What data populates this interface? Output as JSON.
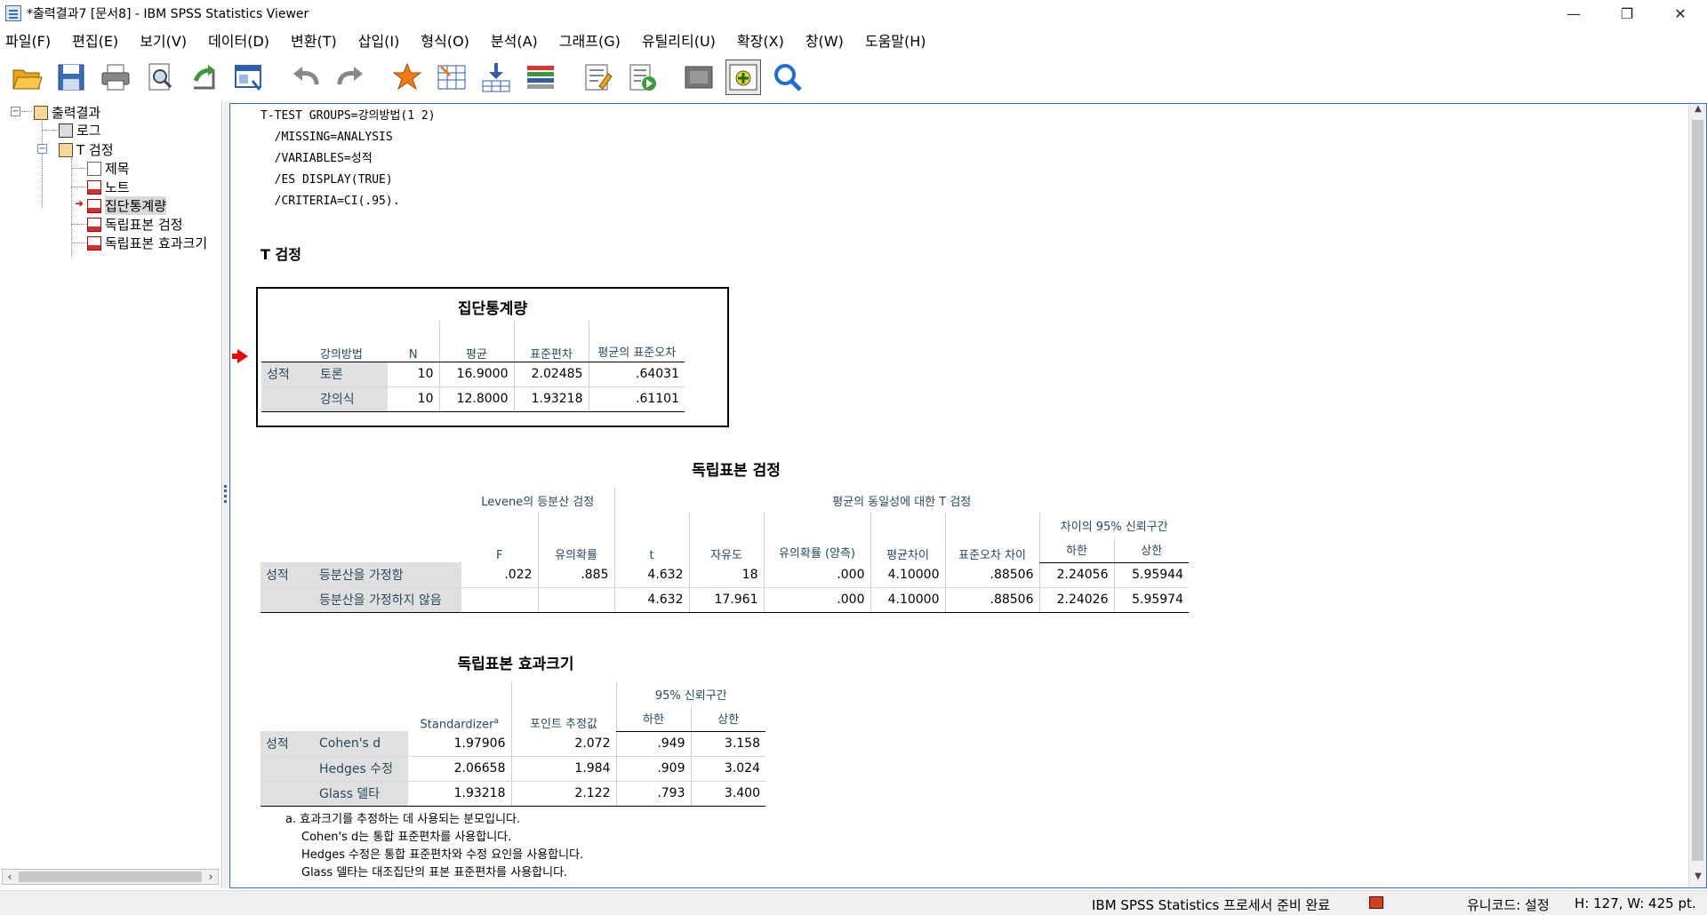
{
  "window": {
    "title": "*출력결과7 [문서8] - IBM SPSS Statistics Viewer",
    "controls": [
      "—",
      "❐",
      "✕"
    ]
  },
  "menu": [
    "파일(F)",
    "편집(E)",
    "보기(V)",
    "데이터(D)",
    "변환(T)",
    "삽입(I)",
    "형식(O)",
    "분석(A)",
    "그래프(G)",
    "유틸리티(U)",
    "확장(X)",
    "창(W)",
    "도움말(H)"
  ],
  "toolbar": {
    "icons": [
      "open-folder-icon",
      "save-icon",
      "print-icon",
      "print-preview-icon",
      "export-icon",
      "recall-dialog-icon",
      "undo-icon",
      "redo-icon",
      "goto-case-icon",
      "goto-variable-icon",
      "insert-cases-icon",
      "variables-icon",
      "insert-heading-icon",
      "insert-text-icon",
      "hide-icon",
      "promote-icon",
      "find-icon"
    ]
  },
  "tree": {
    "root": "출력결과",
    "log": "로그",
    "ttest": "T 검정",
    "title": "제목",
    "notes": "노트",
    "group_stats": "집단통계량",
    "indep_test": "독립표본 검정",
    "effect_size": "독립표본 효과크기"
  },
  "syntax": "T-TEST GROUPS=강의방법(1 2)\n  /MISSING=ANALYSIS\n  /VARIABLES=성적\n  /ES DISPLAY(TRUE)\n  /CRITERIA=CI(.95).",
  "section_heading": "T 검정",
  "group_stats": {
    "title": "집단통계량",
    "headers": [
      "강의방법",
      "N",
      "평균",
      "표준편차",
      "평균의 표준오차"
    ],
    "var": "성적",
    "rows": [
      {
        "label": "토론",
        "n": "10",
        "mean": "16.9000",
        "sd": "2.02485",
        "se": ".64031"
      },
      {
        "label": "강의식",
        "n": "10",
        "mean": "12.8000",
        "sd": "1.93218",
        "se": ".61101"
      }
    ]
  },
  "indep_test": {
    "title": "독립표본 검정",
    "levene_header": "Levene의 등분산 검정",
    "ttest_header": "평균의 동일성에 대한 T 검정",
    "ci_header": "차이의 95% 신뢰구간",
    "cols": [
      "F",
      "유의확률",
      "t",
      "자유도",
      "유의확률 (양측)",
      "평균차이",
      "표준오차 차이",
      "하한",
      "상한"
    ],
    "var": "성적",
    "rows": [
      {
        "label": "등분산을 가정함",
        "f": ".022",
        "sig": ".885",
        "t": "4.632",
        "df": "18",
        "p": ".000",
        "md": "4.10000",
        "sed": ".88506",
        "lo": "2.24056",
        "hi": "5.95944"
      },
      {
        "label": "등분산을 가정하지 않음",
        "f": "",
        "sig": "",
        "t": "4.632",
        "df": "17.961",
        "p": ".000",
        "md": "4.10000",
        "sed": ".88506",
        "lo": "2.24026",
        "hi": "5.95974"
      }
    ]
  },
  "effect_size": {
    "title": "독립표본 효과크기",
    "ci_header": "95% 신뢰구간",
    "cols": [
      "Standardizer",
      "포인트 추정값",
      "하한",
      "상한"
    ],
    "sup": "a",
    "var": "성적",
    "rows": [
      {
        "label": "Cohen's d",
        "std": "1.97906",
        "pt": "2.072",
        "lo": ".949",
        "hi": "3.158"
      },
      {
        "label": "Hedges 수정",
        "std": "2.06658",
        "pt": "1.984",
        "lo": ".909",
        "hi": "3.024"
      },
      {
        "label": "Glass 델타",
        "std": "1.93218",
        "pt": "2.122",
        "lo": ".793",
        "hi": "3.400"
      }
    ],
    "footnotes": [
      "a. 효과크기를 추정하는 데 사용되는 분모입니다.",
      "Cohen's d는 통합 표준편차를 사용합니다.",
      "Hedges 수정은 통합 표준편차와 수정 요인을 사용합니다.",
      "Glass 델타는 대조집단의 표본 표준편차를 사용합니다."
    ]
  },
  "status": {
    "processor": "IBM SPSS Statistics 프로세서 준비 완료",
    "unicode": "유니코드: 설정",
    "size": "H: 127, W: 425 pt."
  }
}
